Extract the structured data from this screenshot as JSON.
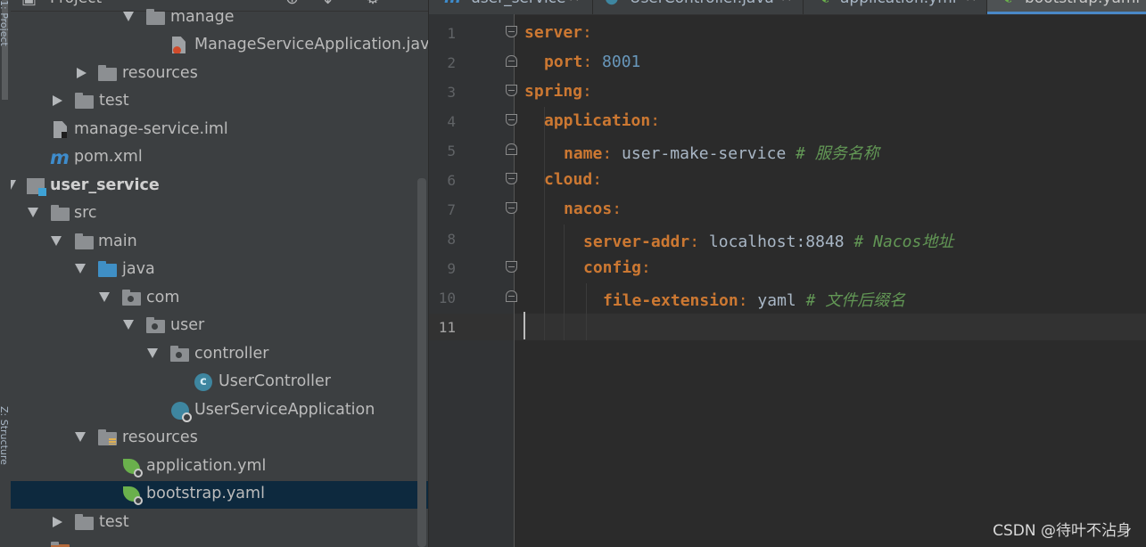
{
  "sidebar_strip": {
    "top_label": "1: Project",
    "bottom_label": "Z: Structure"
  },
  "project_panel": {
    "title": "Project",
    "tree": [
      {
        "label": "manage",
        "kind": "folder",
        "arrow": "down"
      },
      {
        "label": "ManageServiceApplication.java",
        "kind": "java-file",
        "arrow": ""
      },
      {
        "label": "resources",
        "kind": "folder",
        "arrow": "right"
      },
      {
        "label": "test",
        "kind": "folder",
        "arrow": "right"
      },
      {
        "label": "manage-service.iml",
        "kind": "iml-file",
        "arrow": ""
      },
      {
        "label": "pom.xml",
        "kind": "maven-file",
        "arrow": ""
      },
      {
        "label": "user_service",
        "kind": "module",
        "arrow": "down"
      },
      {
        "label": "src",
        "kind": "folder",
        "arrow": "down"
      },
      {
        "label": "main",
        "kind": "folder",
        "arrow": "down"
      },
      {
        "label": "java",
        "kind": "source-folder",
        "arrow": "down"
      },
      {
        "label": "com",
        "kind": "package",
        "arrow": "down"
      },
      {
        "label": "user",
        "kind": "package",
        "arrow": "down"
      },
      {
        "label": "controller",
        "kind": "package",
        "arrow": "down"
      },
      {
        "label": "UserController",
        "kind": "class",
        "arrow": ""
      },
      {
        "label": "UserServiceApplication",
        "kind": "spring-app-class",
        "arrow": ""
      },
      {
        "label": "resources",
        "kind": "resources-folder",
        "arrow": "down"
      },
      {
        "label": "application.yml",
        "kind": "spring-config",
        "arrow": ""
      },
      {
        "label": "bootstrap.yaml",
        "kind": "spring-config",
        "arrow": ""
      },
      {
        "label": "test",
        "kind": "folder",
        "arrow": "right"
      }
    ]
  },
  "tabs": [
    {
      "label": "user_service",
      "icon": "maven-icon"
    },
    {
      "label": "UserController.java",
      "icon": "class-icon"
    },
    {
      "label": "application.yml",
      "icon": "spring-icon"
    },
    {
      "label": "bootstrap.yaml",
      "icon": "spring-icon",
      "active": true
    }
  ],
  "editor": {
    "line_numbers": [
      "1",
      "2",
      "3",
      "4",
      "5",
      "6",
      "7",
      "8",
      "9",
      "10",
      "11"
    ],
    "lines": [
      {
        "key": "server",
        "sep": ":",
        "value": "",
        "comment": ""
      },
      {
        "key": "port",
        "sep": ": ",
        "value": "8001",
        "comment": ""
      },
      {
        "key": "spring",
        "sep": ":",
        "value": "",
        "comment": ""
      },
      {
        "key": "application",
        "sep": ":",
        "value": "",
        "comment": ""
      },
      {
        "key": "name",
        "sep": ": ",
        "value": "user-make-service ",
        "comment": "# 服务名称"
      },
      {
        "key": "cloud",
        "sep": ":",
        "value": "",
        "comment": ""
      },
      {
        "key": "nacos",
        "sep": ":",
        "value": "",
        "comment": ""
      },
      {
        "key": "server-addr",
        "sep": ": ",
        "value": "localhost:8848 ",
        "comment": "# Nacos地址"
      },
      {
        "key": "config",
        "sep": ":",
        "value": "",
        "comment": ""
      },
      {
        "key": "file-extension",
        "sep": ": ",
        "value": "yaml ",
        "comment": "# 文件后缀名"
      }
    ]
  },
  "watermark": "CSDN @待叶不沾身",
  "colors": {
    "keyword": "#cc7832",
    "number": "#6897bb",
    "comment": "#629755",
    "selection": "#0d293e"
  }
}
